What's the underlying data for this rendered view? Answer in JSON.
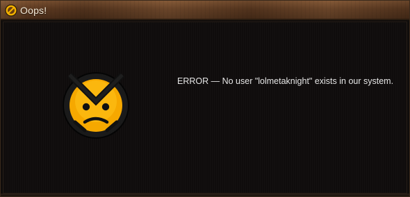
{
  "window": {
    "title": "Oops!",
    "icon": "no-entry-emblem-icon"
  },
  "message": {
    "text": "ERROR — No user \"lolmetaknight\" exists in our system.",
    "icon": "angry-face-icon"
  },
  "colors": {
    "title_bar": "#5d3a21",
    "background": "#100d0c",
    "face_fill": "#f6a800",
    "text": "#e6e6e6"
  }
}
